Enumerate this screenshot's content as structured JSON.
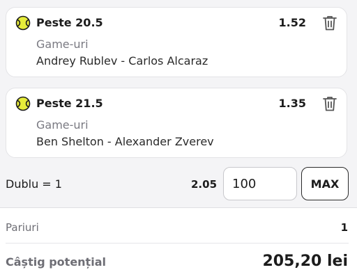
{
  "colors": {
    "ball_fill": "#e6ec3a",
    "ball_stroke": "#1c1c1c",
    "trash": "#555555",
    "muted_text": "#7a7a82"
  },
  "selections": [
    {
      "icon": "tennis-ball-icon",
      "label": "Peste 20.5",
      "odds": "1.52",
      "market": "Game-uri",
      "match": "Andrey Rublev - Carlos Alcaraz",
      "remove_icon": "trash-icon"
    },
    {
      "icon": "tennis-ball-icon",
      "label": "Peste 21.5",
      "odds": "1.35",
      "market": "Game-uri",
      "match": "Ben Shelton - Alexander Zverev",
      "remove_icon": "trash-icon"
    }
  ],
  "combo": {
    "label": "Dublu = 1",
    "odds": "2.05",
    "stake_value": "100",
    "max_label": "MAX"
  },
  "summary": {
    "bets_label": "Pariuri",
    "bets_value": "1",
    "potential_label": "Câștig potențial",
    "potential_value": "205,20 lei"
  }
}
